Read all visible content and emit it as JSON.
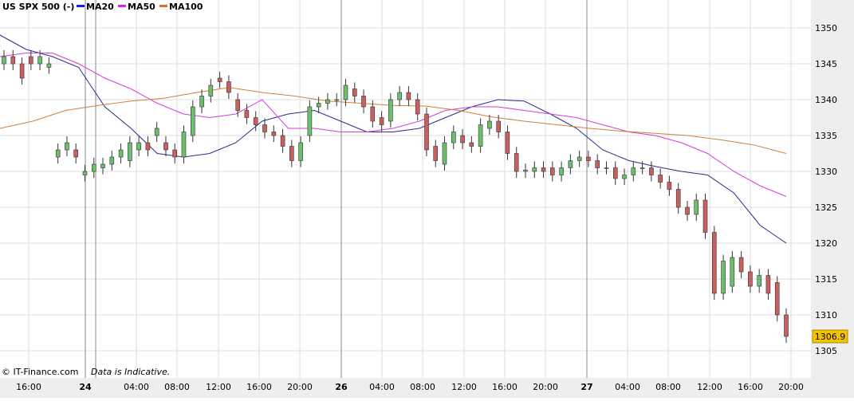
{
  "legend": {
    "instrument": "US SPX 500 (-)",
    "ma20": "MA20",
    "ma50": "MA50",
    "ma100": "MA100"
  },
  "footer": {
    "brand": "© IT-Finance.com",
    "note": "Data is Indicative."
  },
  "colors": {
    "background": "#ffffff",
    "axis_background": "#eeeeee",
    "grid": "#dddddd",
    "up_candle": "#6cbf6c",
    "down_candle": "#c86060",
    "ma20": "#2b2b8c",
    "ma50": "#d63dd6",
    "ma100": "#d2803a",
    "last_price_box": "#f5c400"
  },
  "chart_data": {
    "type": "candlestick",
    "ylim": [
      1303,
      1355
    ],
    "y_ticks": [
      "1350",
      "1345",
      "1340",
      "1335",
      "1330",
      "1325",
      "1320",
      "1315",
      "1310",
      "1305"
    ],
    "x_ticks": [
      "16:00",
      "24",
      "04:00",
      "08:00",
      "12:00",
      "16:00",
      "20:00",
      "26",
      "04:00",
      "08:00",
      "12:00",
      "16:00",
      "20:00",
      "27",
      "04:00",
      "08:00",
      "12:00",
      "16:00",
      "20:00"
    ],
    "last_price": "1306.9",
    "grid": true,
    "series": [
      {
        "name": "MA20",
        "values": [
          1349,
          1347,
          1346,
          1344.5,
          1339,
          1336,
          1332.5,
          1332,
          1332.5,
          1334,
          1337,
          1338,
          1338.5,
          1337,
          1335.5,
          1335.5,
          1336,
          1337.5,
          1339,
          1340,
          1339.8,
          1338,
          1336,
          1333,
          1331.5,
          1330.7,
          1330,
          1329.5,
          1327,
          1322.5,
          1320
        ]
      },
      {
        "name": "MA50",
        "values": [
          1346,
          1346.5,
          1346.5,
          1345,
          1343,
          1341.5,
          1339.5,
          1338,
          1337.5,
          1338,
          1340,
          1336,
          1336,
          1335.5,
          1335.5,
          1336,
          1337,
          1338.5,
          1339,
          1339,
          1338.5,
          1338,
          1337.5,
          1336.5,
          1335.5,
          1335,
          1334,
          1332.5,
          1330,
          1328,
          1326.5
        ]
      },
      {
        "name": "MA100",
        "values": [
          1336,
          1337,
          1338.5,
          1339.2,
          1339.8,
          1340.2,
          1341,
          1341.7,
          1341,
          1340.5,
          1339.8,
          1339.5,
          1339.2,
          1339.1,
          1338.5,
          1337.6,
          1337,
          1336.5,
          1336,
          1335.6,
          1335.3,
          1335,
          1334.4,
          1333.7,
          1332.5
        ]
      },
      {
        "name": "price",
        "open": [
          1345,
          1346,
          1345,
          1346,
          1345,
          1344.5,
          1332,
          1333,
          1333,
          1329.5,
          1330,
          1330.5,
          1331,
          1332,
          1331.5,
          1333,
          1334,
          1335,
          1334,
          1333,
          1332,
          1335,
          1339,
          1340.5,
          1343,
          1342.5,
          1340,
          1338.5,
          1337.5,
          1336.5,
          1335.5,
          1335,
          1333.5,
          1331.5,
          1335,
          1339,
          1339.5,
          1340,
          1340,
          1341.5,
          1340.5,
          1339,
          1337.5,
          1337,
          1340,
          1341,
          1340,
          1338,
          1333.5,
          1331,
          1334,
          1335,
          1334,
          1333.5,
          1336,
          1337,
          1335.5,
          1332.5,
          1330,
          1330,
          1330.5,
          1330.5,
          1329.5,
          1330.5,
          1331.5,
          1332,
          1331.5,
          1330.5,
          1330.5,
          1329,
          1329.5,
          1330.5,
          1330.5,
          1329.5,
          1328.5,
          1327.5,
          1325,
          1324,
          1326,
          1321.5,
          1313,
          1314,
          1318,
          1316,
          1314,
          1315.5,
          1314.5,
          1310
        ],
        "close": [
          1346,
          1345,
          1343,
          1345,
          1346,
          1345,
          1333,
          1334,
          1332,
          1330,
          1331,
          1331,
          1332,
          1333,
          1334,
          1334,
          1333,
          1336,
          1333,
          1332,
          1335.5,
          1339,
          1340.5,
          1342,
          1342.5,
          1341,
          1338.5,
          1337.5,
          1336.5,
          1335.5,
          1335,
          1333.5,
          1331.5,
          1334,
          1339,
          1339.5,
          1340,
          1340,
          1342,
          1340.5,
          1339,
          1337,
          1336.5,
          1340,
          1341,
          1340,
          1338,
          1333,
          1331.5,
          1334,
          1335.5,
          1334,
          1333.5,
          1336.5,
          1337,
          1335.5,
          1332.5,
          1330,
          1330.2,
          1330.5,
          1330,
          1329.5,
          1330.5,
          1331.5,
          1332,
          1331.5,
          1330.5,
          1330.5,
          1329,
          1329.5,
          1330.5,
          1330.5,
          1329.5,
          1328.5,
          1327.5,
          1325,
          1324,
          1326,
          1321.5,
          1313,
          1317.5,
          1318,
          1316,
          1314,
          1315.5,
          1313,
          1310,
          1307
        ]
      }
    ]
  }
}
